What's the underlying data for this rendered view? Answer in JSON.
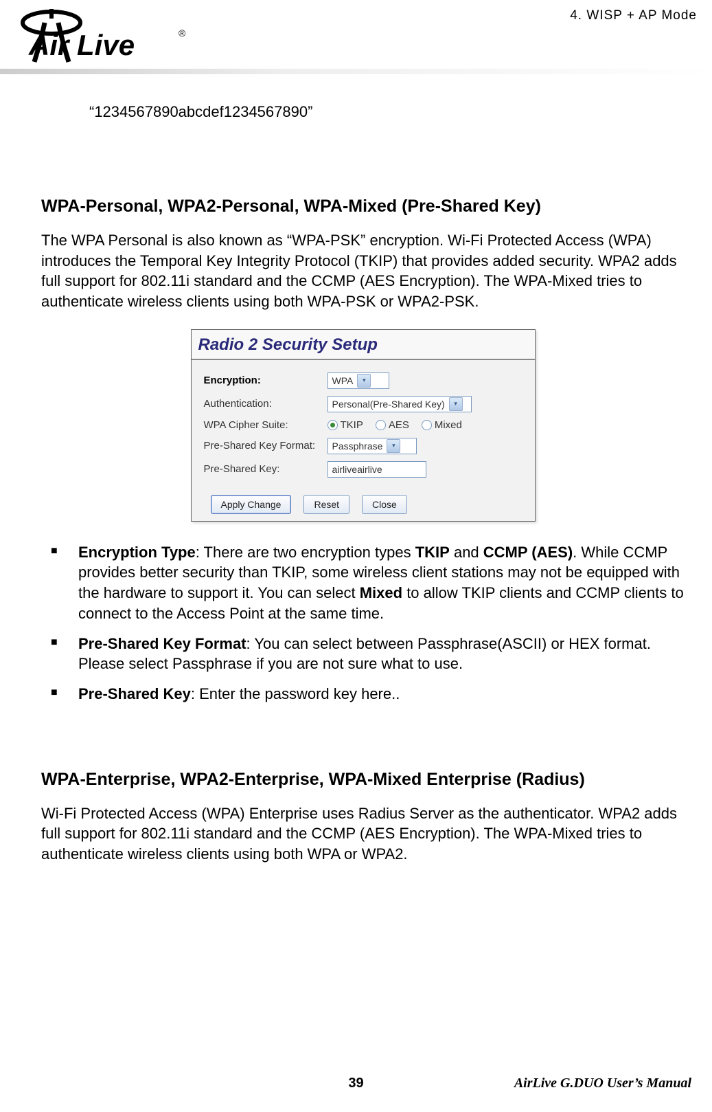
{
  "header": {
    "chapter": "4.  WISP  +  AP  Mode",
    "logo_text_1": "AirLive",
    "logo_text_2": "®"
  },
  "key_example": "“1234567890abcdef1234567890”",
  "section1": {
    "heading": "WPA-Personal, WPA2-Personal, WPA-Mixed (Pre-Shared Key)",
    "para": "The WPA Personal is also known as “WPA-PSK” encryption.    Wi-Fi Protected Access (WPA) introduces the Temporal Key Integrity Protocol (TKIP) that provides added security.    WPA2 adds full support for 802.11i standard and the CCMP (AES Encryption). The WPA-Mixed tries to authenticate wireless clients using both WPA-PSK or WPA2-PSK."
  },
  "dialog": {
    "title": "Radio 2 Security Setup",
    "encryption_label": "Encryption:",
    "encryption_value": "WPA",
    "auth_label": "Authentication:",
    "auth_value": "Personal(Pre-Shared Key)",
    "cipher_label": "WPA Cipher Suite:",
    "cipher_options": {
      "tkip": "TKIP",
      "aes": "AES",
      "mixed": "Mixed"
    },
    "psk_fmt_label": "Pre-Shared Key Format:",
    "psk_fmt_value": "Passphrase",
    "psk_label": "Pre-Shared Key:",
    "psk_value": "airliveairlive",
    "buttons": {
      "apply": "Apply Change",
      "reset": "Reset",
      "close": "Close"
    }
  },
  "bullets": {
    "b1_bold": "Encryption Type",
    "b1_text_a": ":   There are two encryption types ",
    "b1_bold2": "TKIP",
    "b1_text_b": " and ",
    "b1_bold3": "CCMP (AES)",
    "b1_text_c": ". While CCMP provides better security than TKIP, some wireless client stations may not be equipped with the hardware to support it. You can select ",
    "b1_bold4": "Mixed",
    "b1_text_d": " to allow TKIP clients and CCMP clients to connect to the Access Point at the same time.",
    "b2_bold": "Pre-Shared Key Format",
    "b2_text": ":    You can select between Passphrase(ASCII) or HEX format.    Please select Passphrase if you are not sure what to use.",
    "b3_bold": "Pre-Shared Key",
    "b3_text": ":    Enter the password key here.."
  },
  "section2": {
    "heading": "WPA-Enterprise, WPA2-Enterprise, WPA-Mixed Enterprise (Radius)",
    "para": "Wi-Fi Protected Access (WPA) Enterprise uses Radius Server as the authenticator. WPA2 adds full support for 802.11i standard and the CCMP (AES Encryption).    The WPA-Mixed tries to authenticate wireless clients using both WPA or WPA2."
  },
  "footer": {
    "page_num": "39",
    "manual": "AirLive  G.DUO  User’s  Manual"
  }
}
